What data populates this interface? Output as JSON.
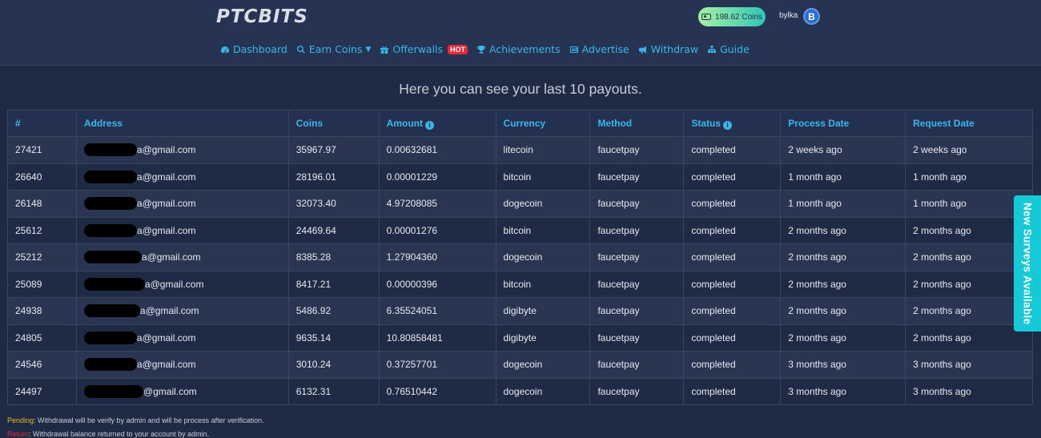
{
  "brand": {
    "logo": "PTCBITS"
  },
  "header": {
    "balance": "198.62 Coins",
    "username": "bylka",
    "avatar_letter": "B"
  },
  "nav": [
    {
      "label": "Dashboard",
      "icon": "dashboard-icon"
    },
    {
      "label": "Earn Coins",
      "icon": "search-icon",
      "dropdown": true
    },
    {
      "label": "Offerwalls",
      "icon": "gift-icon",
      "badge": "HOT"
    },
    {
      "label": "Achievements",
      "icon": "trophy-icon"
    },
    {
      "label": "Advertise",
      "icon": "ad-icon"
    },
    {
      "label": "Withdraw",
      "icon": "megaphone-icon"
    },
    {
      "label": "Guide",
      "icon": "sitemap-icon"
    }
  ],
  "page_title": "Here you can see your last 10 payouts.",
  "table": {
    "headers": [
      "#",
      "Address",
      "Coins",
      "Amount",
      "Currency",
      "Method",
      "Status",
      "Process Date",
      "Request Date"
    ],
    "rows": [
      {
        "id": "27421",
        "address": "a@gmail.com",
        "coins": "35967.97",
        "amount": "0.00632681",
        "currency": "litecoin",
        "method": "faucetpay",
        "status": "completed",
        "process": "2 weeks ago",
        "request": "2 weeks ago"
      },
      {
        "id": "26640",
        "address": "a@gmail.com",
        "coins": "28196.01",
        "amount": "0.00001229",
        "currency": "bitcoin",
        "method": "faucetpay",
        "status": "completed",
        "process": "1 month ago",
        "request": "1 month ago"
      },
      {
        "id": "26148",
        "address": "a@gmail.com",
        "coins": "32073.40",
        "amount": "4.97208085",
        "currency": "dogecoin",
        "method": "faucetpay",
        "status": "completed",
        "process": "1 month ago",
        "request": "1 month ago"
      },
      {
        "id": "25612",
        "address": "a@gmail.com",
        "coins": "24469.64",
        "amount": "0.00001276",
        "currency": "bitcoin",
        "method": "faucetpay",
        "status": "completed",
        "process": "2 months ago",
        "request": "2 months ago"
      },
      {
        "id": "25212",
        "address": "a@gmail.com",
        "coins": "8385.28",
        "amount": "1.27904360",
        "currency": "dogecoin",
        "method": "faucetpay",
        "status": "completed",
        "process": "2 months ago",
        "request": "2 months ago"
      },
      {
        "id": "25089",
        "address": "a@gmail.com",
        "coins": "8417.21",
        "amount": "0.00000396",
        "currency": "bitcoin",
        "method": "faucetpay",
        "status": "completed",
        "process": "2 months ago",
        "request": "2 months ago"
      },
      {
        "id": "24938",
        "address": "a@gmail.com",
        "coins": "5486.92",
        "amount": "6.35524051",
        "currency": "digibyte",
        "method": "faucetpay",
        "status": "completed",
        "process": "2 months ago",
        "request": "2 months ago"
      },
      {
        "id": "24805",
        "address": "a@gmail.com",
        "coins": "9635.14",
        "amount": "10.80858481",
        "currency": "digibyte",
        "method": "faucetpay",
        "status": "completed",
        "process": "2 months ago",
        "request": "2 months ago"
      },
      {
        "id": "24546",
        "address": "a@gmail.com",
        "coins": "3010.24",
        "amount": "0.37257701",
        "currency": "dogecoin",
        "method": "faucetpay",
        "status": "completed",
        "process": "3 months ago",
        "request": "3 months ago"
      },
      {
        "id": "24497",
        "address": "@gmail.com",
        "coins": "6132.31",
        "amount": "0.76510442",
        "currency": "dogecoin",
        "method": "faucetpay",
        "status": "completed",
        "process": "3 months ago",
        "request": "3 months ago"
      }
    ]
  },
  "side_tab": "New Surveys Available",
  "legend": [
    {
      "key": "Pending",
      "text": ": Withdrawal will be verify by admin and will be process after verification."
    },
    {
      "key": "Return",
      "text": ": Withdrawal balance returned to your account by admin."
    }
  ],
  "colors": {
    "accent": "#38b8e8",
    "background": "#1f2b45",
    "header": "#263352",
    "hot": "#e8283a",
    "pending": "#f0b429",
    "return": "#e8283a",
    "side_tab": "#16c9d6"
  }
}
